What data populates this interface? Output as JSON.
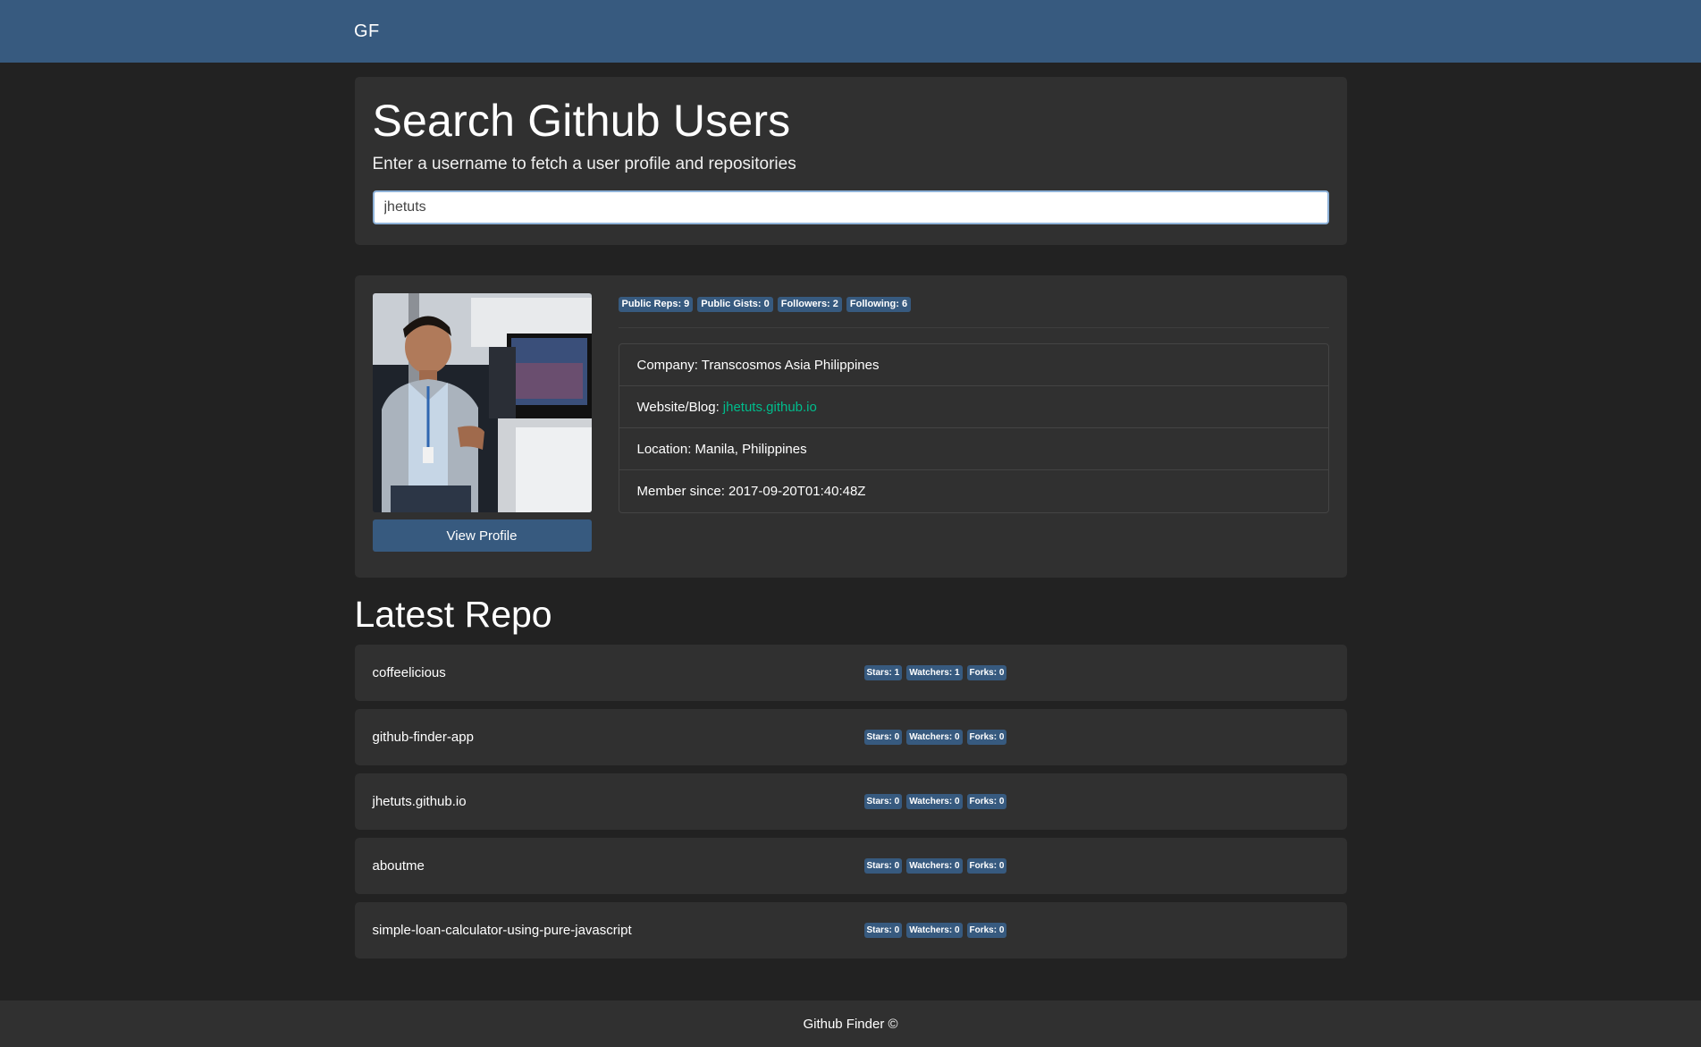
{
  "nav": {
    "brand": "GF"
  },
  "search": {
    "title": "Search Github Users",
    "subtitle": "Enter a username to fetch a user profile and repositories",
    "value": "jhetuts"
  },
  "profile": {
    "avatar_alt": "avatar",
    "view_profile_label": "View Profile",
    "badges": {
      "public_repos": "Public Reps: 9",
      "public_gists": "Public Gists: 0",
      "followers": "Followers: 2",
      "following": "Following: 6"
    },
    "company": "Company: Transcosmos Asia Philippines",
    "website_label": "Website/Blog:",
    "website_value": "jhetuts.github.io",
    "location": "Location: Manila, Philippines",
    "member_since": "Member since: 2017-09-20T01:40:48Z"
  },
  "repos": {
    "heading": "Latest Repo",
    "items": [
      {
        "name": "coffeelicious",
        "stars": "Stars: 1",
        "watchers": "Watchers: 1",
        "forks": "Forks: 0"
      },
      {
        "name": "github-finder-app",
        "stars": "Stars: 0",
        "watchers": "Watchers: 0",
        "forks": "Forks: 0"
      },
      {
        "name": "jhetuts.github.io",
        "stars": "Stars: 0",
        "watchers": "Watchers: 0",
        "forks": "Forks: 0"
      },
      {
        "name": "aboutme",
        "stars": "Stars: 0",
        "watchers": "Watchers: 0",
        "forks": "Forks: 0"
      },
      {
        "name": "simple-loan-calculator-using-pure-javascript",
        "stars": "Stars: 0",
        "watchers": "Watchers: 0",
        "forks": "Forks: 0"
      }
    ]
  },
  "footer": {
    "text": "Github Finder ©"
  },
  "colors": {
    "navbar": "#375a7f",
    "background": "#222222",
    "card": "#303030",
    "badge": "#375a7f",
    "link": "#00bc8c"
  }
}
